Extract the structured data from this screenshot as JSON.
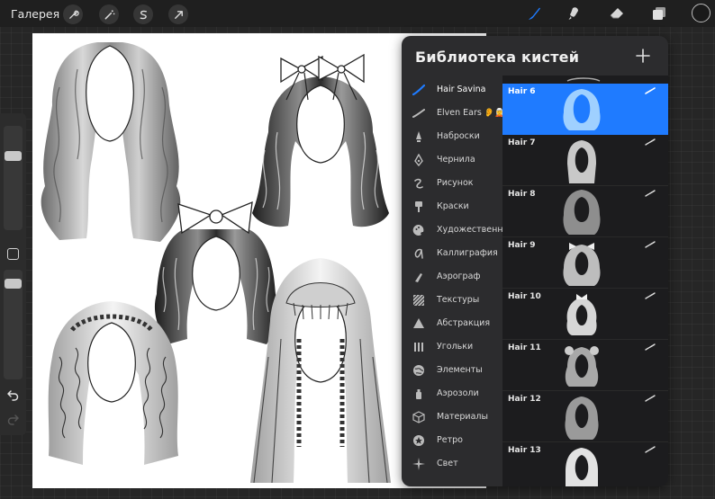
{
  "toolbar": {
    "gallery_label": "Галерея",
    "left_tools": [
      "wrench-icon",
      "magic-wand-icon",
      "selection-icon",
      "transform-arrow-icon"
    ],
    "right_tools": [
      "brush-icon",
      "smudge-icon",
      "eraser-icon",
      "layers-icon"
    ],
    "active_tool": "brush-icon",
    "accent_color": "#1f7bff",
    "current_color": "#1a1a1a"
  },
  "sidebar": {
    "size_slider_level": 0.78,
    "opacity_slider_level": 0.78,
    "icons": [
      "modifier-square-icon",
      "undo-icon",
      "redo-icon"
    ]
  },
  "brush_library": {
    "title": "Библиотека кистей",
    "add_icon": "plus-icon",
    "categories": [
      {
        "label": "Hair Savina",
        "icon": "hair-savina-icon",
        "active": true
      },
      {
        "label": "Elven Ears",
        "icon": "elven-ears-icon",
        "emoji": "👂🧝"
      },
      {
        "label": "Наброски",
        "icon": "sketch-icon"
      },
      {
        "label": "Чернила",
        "icon": "ink-icon"
      },
      {
        "label": "Рисунок",
        "icon": "drawing-icon"
      },
      {
        "label": "Краски",
        "icon": "paint-icon"
      },
      {
        "label": "Художественные",
        "icon": "artistic-icon"
      },
      {
        "label": "Каллиграфия",
        "icon": "calligraphy-icon"
      },
      {
        "label": "Аэрограф",
        "icon": "airbrush-icon"
      },
      {
        "label": "Текстуры",
        "icon": "textures-icon"
      },
      {
        "label": "Абстракция",
        "icon": "abstract-icon"
      },
      {
        "label": "Угольки",
        "icon": "charcoal-icon"
      },
      {
        "label": "Элементы",
        "icon": "elements-icon"
      },
      {
        "label": "Аэрозоли",
        "icon": "spray-icon"
      },
      {
        "label": "Материалы",
        "icon": "materials-icon"
      },
      {
        "label": "Ретро",
        "icon": "retro-icon"
      },
      {
        "label": "Свет",
        "icon": "light-icon"
      }
    ],
    "brushes": [
      {
        "name": "Hair 6",
        "selected": true
      },
      {
        "name": "Hair 7"
      },
      {
        "name": "Hair 8"
      },
      {
        "name": "Hair 9"
      },
      {
        "name": "Hair 10"
      },
      {
        "name": "Hair 11"
      },
      {
        "name": "Hair 12"
      },
      {
        "name": "Hair 13"
      }
    ]
  },
  "canvas": {
    "illustrations": [
      "hairstyle-long-wavy",
      "hairstyle-double-bows",
      "hairstyle-ponytail-bow",
      "hairstyle-curly-braid-crown",
      "hairstyle-bangs-braids"
    ]
  }
}
